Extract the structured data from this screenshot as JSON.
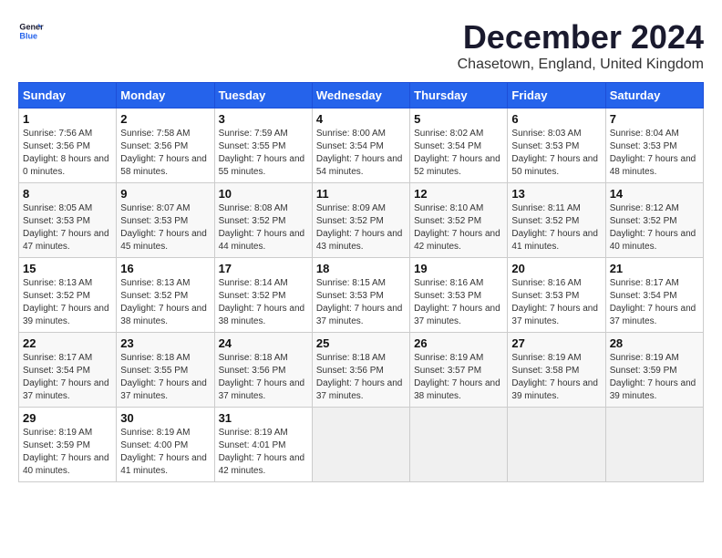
{
  "logo": {
    "text_general": "General",
    "text_blue": "Blue"
  },
  "title": "December 2024",
  "subtitle": "Chasetown, England, United Kingdom",
  "days_of_week": [
    "Sunday",
    "Monday",
    "Tuesday",
    "Wednesday",
    "Thursday",
    "Friday",
    "Saturday"
  ],
  "weeks": [
    [
      {
        "day": "1",
        "sunrise": "7:56 AM",
        "sunset": "3:56 PM",
        "daylight": "8 hours and 0 minutes."
      },
      {
        "day": "2",
        "sunrise": "7:58 AM",
        "sunset": "3:56 PM",
        "daylight": "7 hours and 58 minutes."
      },
      {
        "day": "3",
        "sunrise": "7:59 AM",
        "sunset": "3:55 PM",
        "daylight": "7 hours and 55 minutes."
      },
      {
        "day": "4",
        "sunrise": "8:00 AM",
        "sunset": "3:54 PM",
        "daylight": "7 hours and 54 minutes."
      },
      {
        "day": "5",
        "sunrise": "8:02 AM",
        "sunset": "3:54 PM",
        "daylight": "7 hours and 52 minutes."
      },
      {
        "day": "6",
        "sunrise": "8:03 AM",
        "sunset": "3:53 PM",
        "daylight": "7 hours and 50 minutes."
      },
      {
        "day": "7",
        "sunrise": "8:04 AM",
        "sunset": "3:53 PM",
        "daylight": "7 hours and 48 minutes."
      }
    ],
    [
      {
        "day": "8",
        "sunrise": "8:05 AM",
        "sunset": "3:53 PM",
        "daylight": "7 hours and 47 minutes."
      },
      {
        "day": "9",
        "sunrise": "8:07 AM",
        "sunset": "3:53 PM",
        "daylight": "7 hours and 45 minutes."
      },
      {
        "day": "10",
        "sunrise": "8:08 AM",
        "sunset": "3:52 PM",
        "daylight": "7 hours and 44 minutes."
      },
      {
        "day": "11",
        "sunrise": "8:09 AM",
        "sunset": "3:52 PM",
        "daylight": "7 hours and 43 minutes."
      },
      {
        "day": "12",
        "sunrise": "8:10 AM",
        "sunset": "3:52 PM",
        "daylight": "7 hours and 42 minutes."
      },
      {
        "day": "13",
        "sunrise": "8:11 AM",
        "sunset": "3:52 PM",
        "daylight": "7 hours and 41 minutes."
      },
      {
        "day": "14",
        "sunrise": "8:12 AM",
        "sunset": "3:52 PM",
        "daylight": "7 hours and 40 minutes."
      }
    ],
    [
      {
        "day": "15",
        "sunrise": "8:13 AM",
        "sunset": "3:52 PM",
        "daylight": "7 hours and 39 minutes."
      },
      {
        "day": "16",
        "sunrise": "8:13 AM",
        "sunset": "3:52 PM",
        "daylight": "7 hours and 38 minutes."
      },
      {
        "day": "17",
        "sunrise": "8:14 AM",
        "sunset": "3:52 PM",
        "daylight": "7 hours and 38 minutes."
      },
      {
        "day": "18",
        "sunrise": "8:15 AM",
        "sunset": "3:53 PM",
        "daylight": "7 hours and 37 minutes."
      },
      {
        "day": "19",
        "sunrise": "8:16 AM",
        "sunset": "3:53 PM",
        "daylight": "7 hours and 37 minutes."
      },
      {
        "day": "20",
        "sunrise": "8:16 AM",
        "sunset": "3:53 PM",
        "daylight": "7 hours and 37 minutes."
      },
      {
        "day": "21",
        "sunrise": "8:17 AM",
        "sunset": "3:54 PM",
        "daylight": "7 hours and 37 minutes."
      }
    ],
    [
      {
        "day": "22",
        "sunrise": "8:17 AM",
        "sunset": "3:54 PM",
        "daylight": "7 hours and 37 minutes."
      },
      {
        "day": "23",
        "sunrise": "8:18 AM",
        "sunset": "3:55 PM",
        "daylight": "7 hours and 37 minutes."
      },
      {
        "day": "24",
        "sunrise": "8:18 AM",
        "sunset": "3:56 PM",
        "daylight": "7 hours and 37 minutes."
      },
      {
        "day": "25",
        "sunrise": "8:18 AM",
        "sunset": "3:56 PM",
        "daylight": "7 hours and 37 minutes."
      },
      {
        "day": "26",
        "sunrise": "8:19 AM",
        "sunset": "3:57 PM",
        "daylight": "7 hours and 38 minutes."
      },
      {
        "day": "27",
        "sunrise": "8:19 AM",
        "sunset": "3:58 PM",
        "daylight": "7 hours and 39 minutes."
      },
      {
        "day": "28",
        "sunrise": "8:19 AM",
        "sunset": "3:59 PM",
        "daylight": "7 hours and 39 minutes."
      }
    ],
    [
      {
        "day": "29",
        "sunrise": "8:19 AM",
        "sunset": "3:59 PM",
        "daylight": "7 hours and 40 minutes."
      },
      {
        "day": "30",
        "sunrise": "8:19 AM",
        "sunset": "4:00 PM",
        "daylight": "7 hours and 41 minutes."
      },
      {
        "day": "31",
        "sunrise": "8:19 AM",
        "sunset": "4:01 PM",
        "daylight": "7 hours and 42 minutes."
      },
      null,
      null,
      null,
      null
    ]
  ]
}
